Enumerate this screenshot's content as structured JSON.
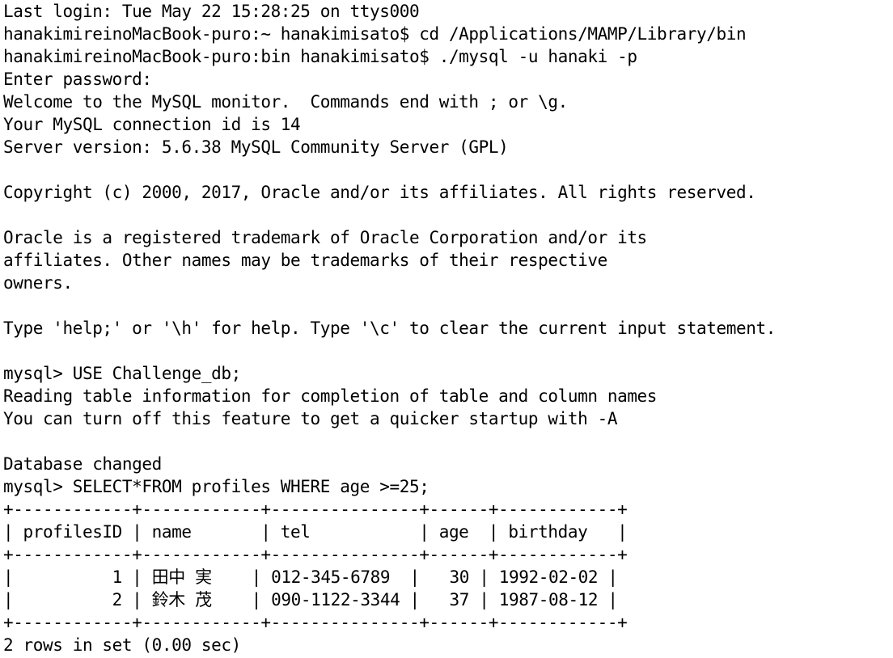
{
  "terminal": {
    "lines": [
      "Last login: Tue May 22 15:28:25 on ttys000",
      "hanakimireinoMacBook-puro:~ hanakimisato$ cd /Applications/MAMP/Library/bin",
      "hanakimireinoMacBook-puro:bin hanakimisato$ ./mysql -u hanaki -p",
      "Enter password:",
      "Welcome to the MySQL monitor.  Commands end with ; or \\g.",
      "Your MySQL connection id is 14",
      "Server version: 5.6.38 MySQL Community Server (GPL)",
      "",
      "Copyright (c) 2000, 2017, Oracle and/or its affiliates. All rights reserved.",
      "",
      "Oracle is a registered trademark of Oracle Corporation and/or its",
      "affiliates. Other names may be trademarks of their respective",
      "owners.",
      "",
      "Type 'help;' or '\\h' for help. Type '\\c' to clear the current input statement.",
      "",
      "mysql> USE Challenge_db;",
      "Reading table information for completion of table and column names",
      "You can turn off this feature to get a quicker startup with -A",
      "",
      "Database changed",
      "mysql> SELECT*FROM profiles WHERE age >=25;",
      "+------------+------------+---------------+------+------------+",
      "| profilesID | name       | tel           | age  | birthday   |",
      "+------------+------------+---------------+------+------------+",
      "|          1 | 田中 実    | 012-345-6789  |   30 | 1992-02-02 |",
      "|          2 | 鈴木 茂    | 090-1122-3344 |   37 | 1987-08-12 |",
      "+------------+------------+---------------+------+------------+",
      "2 rows in set (0.00 sec)"
    ]
  }
}
